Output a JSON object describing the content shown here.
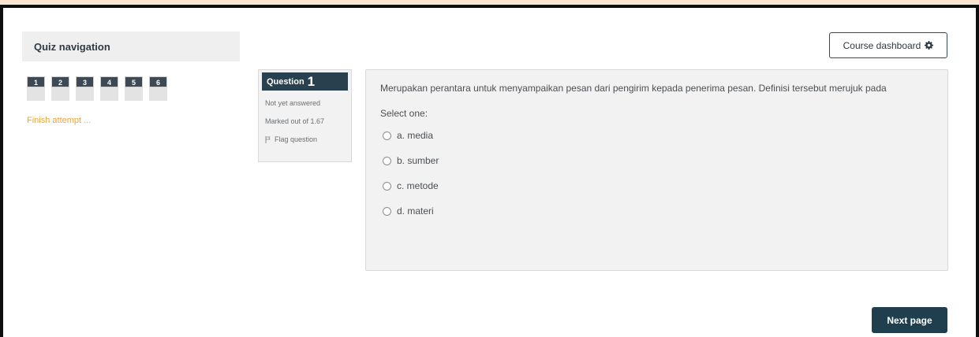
{
  "quiz_navigation": {
    "title": "Quiz navigation",
    "questions": [
      "1",
      "2",
      "3",
      "4",
      "5",
      "6"
    ],
    "finish_label": "Finish attempt ..."
  },
  "header": {
    "course_dashboard_label": "Course dashboard"
  },
  "question_info": {
    "label": "Question",
    "number": "1",
    "state": "Not yet answered",
    "grade": "Marked out of 1.67",
    "flag_label": "Flag question"
  },
  "question": {
    "text": "Merupakan perantara untuk menyampaikan pesan dari pengirim kepada penerima pesan. Definisi tersebut merujuk pada",
    "prompt": "Select one:",
    "options": [
      "a. media",
      "b. sumber",
      "c. metode",
      "d. materi"
    ]
  },
  "footer": {
    "next_label": "Next page"
  },
  "colors": {
    "page_border_bg": "#fbe7cf",
    "primary": "#1f3f4e",
    "link": "#f0a43c"
  },
  "icons": {
    "dashboard": "gear-icon",
    "flag": "flag-icon"
  }
}
